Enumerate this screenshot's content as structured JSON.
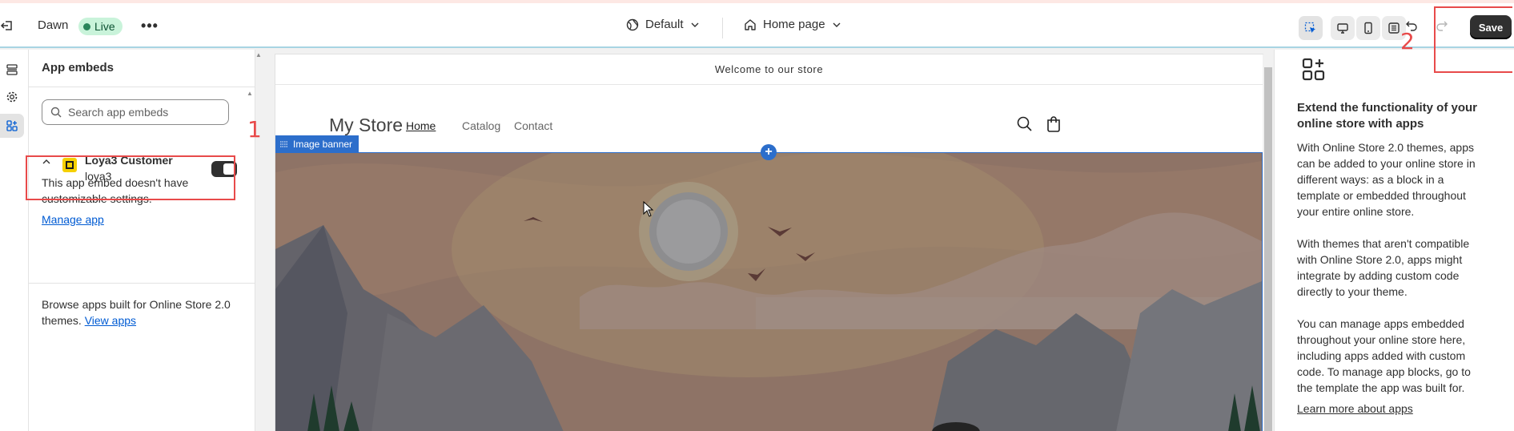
{
  "topbar": {
    "theme_name": "Dawn",
    "status_badge": "Live",
    "more_label": "•••",
    "preview_context": "Default",
    "page_select": "Home page",
    "save_label": "Save"
  },
  "sidebar": {
    "title": "App embeds",
    "search_placeholder": "Search app embeds",
    "app": {
      "name": "Loya3 Customer",
      "developer": "loya3",
      "enabled": true
    },
    "no_settings_line1": "This app embed doesn't have",
    "no_settings_line2": "customizable settings.",
    "manage_app_link": "Manage app",
    "browse_line1": "Browse apps built for Online Store 2.0",
    "browse_line2_prefix": "themes.",
    "view_apps_link": "View apps"
  },
  "preview": {
    "announcement": "Welcome to our store",
    "store_name": "My Store",
    "nav": [
      "Home",
      "Catalog",
      "Contact"
    ],
    "section_tag": "Image banner"
  },
  "info_panel": {
    "title_line1": "Extend the functionality of your",
    "title_line2": "online store with apps",
    "p1": [
      "With Online Store 2.0 themes, apps",
      "can be added to your online store in",
      "different ways: as a block in a",
      "template or embedded throughout",
      "your entire online store."
    ],
    "p2": [
      "With themes that aren't compatible",
      "with Online Store 2.0, apps might",
      "integrate by adding custom code",
      "directly to your theme."
    ],
    "p3": [
      "You can manage apps embedded",
      "throughout your online store here,",
      "including apps added with custom",
      "code. To manage app blocks, go to",
      "the template the app was built for."
    ],
    "learn_more_link": "Learn more about apps"
  },
  "annotations": {
    "label_1": "1",
    "label_2": "2",
    "color": "#e84a4a"
  },
  "colors": {
    "accent_blue": "#2c6ecb",
    "live_green": "#29845a",
    "primary_dark": "#303030",
    "banner_base": "#8c7367"
  }
}
